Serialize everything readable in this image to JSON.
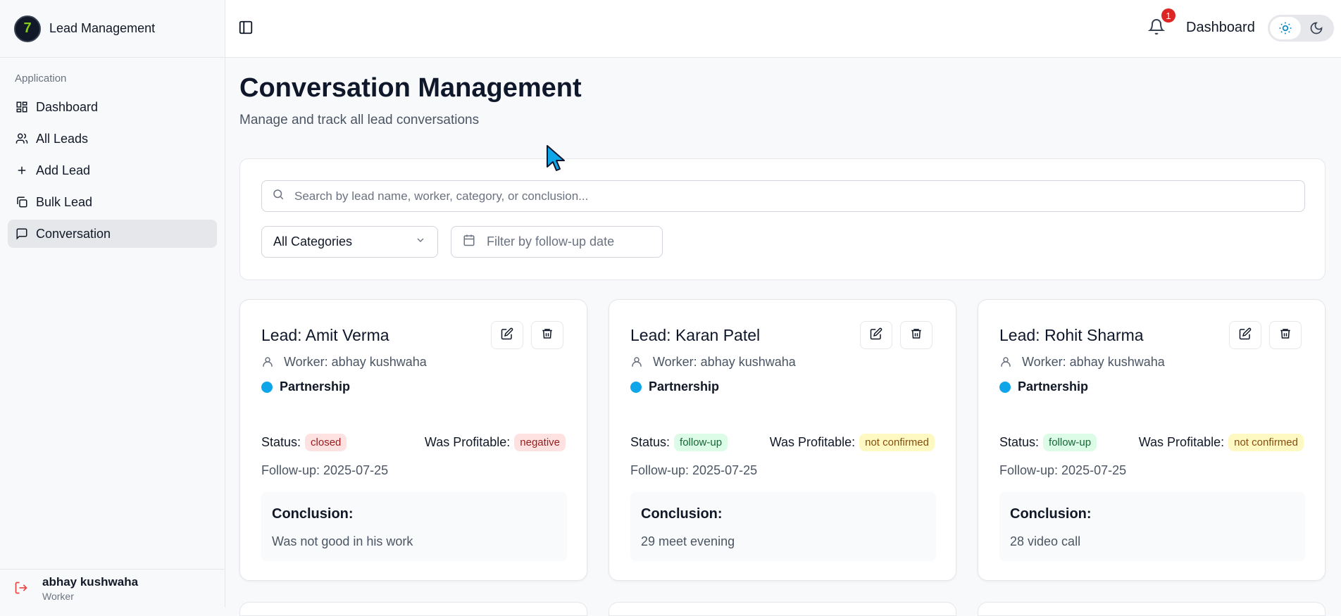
{
  "app": {
    "title": "Lead Management"
  },
  "sidebar": {
    "section_label": "Application",
    "items": [
      {
        "label": "Dashboard",
        "icon": "grid-icon"
      },
      {
        "label": "All Leads",
        "icon": "users-icon"
      },
      {
        "label": "Add Lead",
        "icon": "plus-icon"
      },
      {
        "label": "Bulk Lead",
        "icon": "copy-icon"
      },
      {
        "label": "Conversation",
        "icon": "message-icon",
        "active": true
      }
    ],
    "user": {
      "name": "abhay kushwaha",
      "role": "Worker"
    }
  },
  "header": {
    "notification_count": "1",
    "nav_label": "Dashboard"
  },
  "page": {
    "title": "Conversation Management",
    "subtitle": "Manage and track all lead conversations"
  },
  "filters": {
    "search_placeholder": "Search by lead name, worker, category, or conclusion...",
    "category_selected": "All Categories",
    "date_placeholder": "Filter by follow-up date"
  },
  "labels": {
    "status": "Status:",
    "profitable": "Was Profitable:",
    "conclusion": "Conclusion:"
  },
  "cards": [
    {
      "title": "Lead: Amit Verma",
      "worker": "Worker: abhay kushwaha",
      "category": "Partnership",
      "status": "closed",
      "profitable": "negative",
      "followup": "Follow-up: 2025-07-25",
      "conclusion": "Was not good in his work"
    },
    {
      "title": "Lead: Karan Patel",
      "worker": "Worker: abhay kushwaha",
      "category": "Partnership",
      "status": "follow-up",
      "profitable": "not confirmed",
      "followup": "Follow-up: 2025-07-25",
      "conclusion": "29 meet evening"
    },
    {
      "title": "Lead: Rohit Sharma",
      "worker": "Worker: abhay kushwaha",
      "category": "Partnership",
      "status": "follow-up",
      "profitable": "not confirmed",
      "followup": "Follow-up: 2025-07-25",
      "conclusion": "28 video call"
    }
  ],
  "colors": {
    "category_dot": "#0ea5e9",
    "badge": "#dc2626",
    "logout": "#ef4444"
  }
}
